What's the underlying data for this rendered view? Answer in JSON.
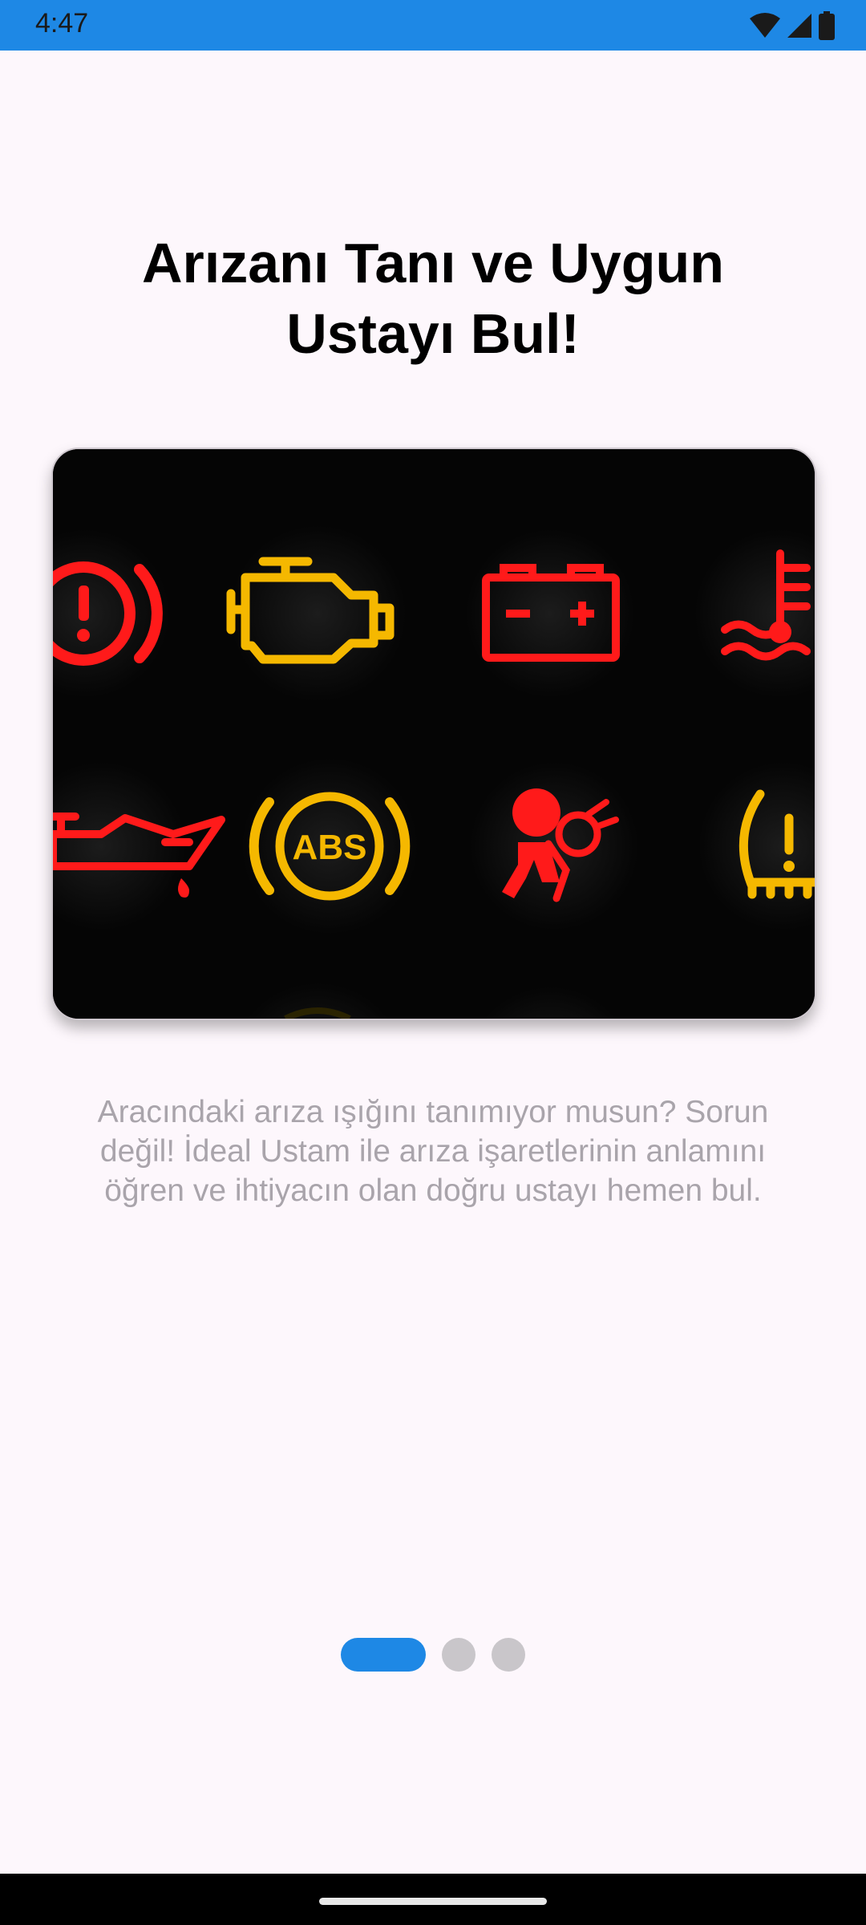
{
  "status_bar": {
    "time": "4:47",
    "background": "#1e88e5",
    "icons": [
      "wifi-icon",
      "signal-icon",
      "battery-icon"
    ]
  },
  "onboarding": {
    "title_line1": "Arızanı Tanı ve Uygun",
    "title_line2": "Ustayı Bul!",
    "image": {
      "description_icons": [
        "brake-warning-icon",
        "check-engine-icon",
        "battery-warning-icon",
        "coolant-temperature-icon",
        "oil-pressure-icon",
        "abs-warning-icon",
        "airbag-warning-icon",
        "tire-pressure-icon"
      ],
      "abs_label": "ABS",
      "battery_minus": "–",
      "battery_plus": "+"
    },
    "description": "Aracındaki arıza ışığını tanımıyor musun? Sorun değil! İdeal Ustam ile arıza işaretlerinin anlamını öğren ve ihtiyacın olan doğru ustayı hemen bul."
  },
  "pager": {
    "total": 3,
    "active_index": 0,
    "active_color": "#1e88e5",
    "inactive_color": "#c9c6ca"
  },
  "colors": {
    "warning_red": "#ff1a1a",
    "warning_amber": "#f5b800",
    "background": "#fdf7fc"
  }
}
